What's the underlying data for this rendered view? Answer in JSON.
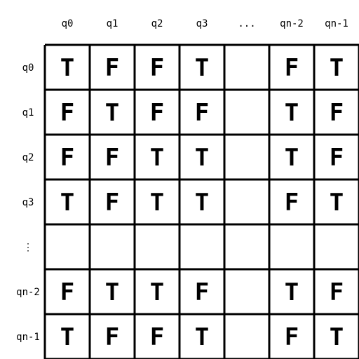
{
  "column_headers": [
    "q0",
    "q1",
    "q2",
    "q3",
    "...",
    "qn-2",
    "qn-1"
  ],
  "row_headers": [
    "q0",
    "q1",
    "q2",
    "q3",
    "⋮",
    "qn-2",
    "qn-1"
  ],
  "cells": [
    [
      "T",
      "F",
      "F",
      "T",
      "",
      "F",
      "T"
    ],
    [
      "F",
      "T",
      "F",
      "F",
      "",
      "T",
      "F"
    ],
    [
      "F",
      "F",
      "T",
      "T",
      "",
      "T",
      "F"
    ],
    [
      "T",
      "F",
      "T",
      "T",
      "",
      "F",
      "T"
    ],
    [
      "",
      "",
      "",
      "",
      "",
      "",
      ""
    ],
    [
      "F",
      "T",
      "T",
      "F",
      "",
      "T",
      "F"
    ],
    [
      "T",
      "F",
      "F",
      "T",
      "",
      "F",
      "T"
    ]
  ],
  "colors": {
    "true_value": "#e8201f",
    "false_value": "#000000",
    "grid": "#000000"
  }
}
